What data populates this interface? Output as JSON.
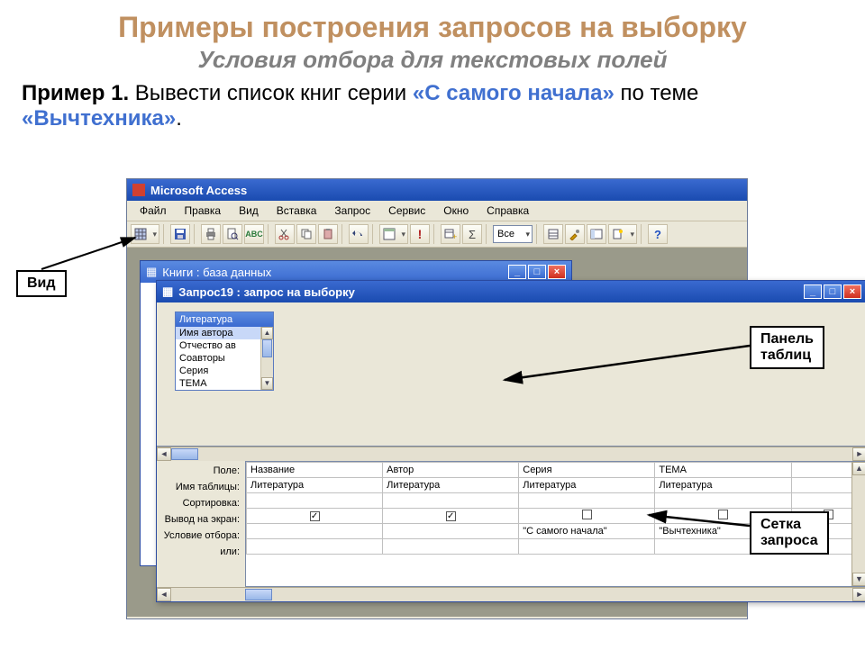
{
  "slide": {
    "title": "Примеры построения запросов на выборку",
    "subtitle": "Условия отбора для текстовых полей",
    "ex_prefix": "Пример 1.",
    "ex_body1": " Вывести список книг серии ",
    "ex_blue1": "«С самого начала»",
    "ex_body2": " по теме ",
    "ex_blue2": "«Вычтехника»",
    "ex_tail": "."
  },
  "callouts": {
    "view": "Вид",
    "tables_panel": "Панель\nтаблиц",
    "query_grid": "Сетка\nзапроса"
  },
  "access": {
    "app_title": "Microsoft Access",
    "menus": [
      "Файл",
      "Правка",
      "Вид",
      "Вставка",
      "Запрос",
      "Сервис",
      "Окно",
      "Справка"
    ],
    "combo_all": "Все",
    "db_window_title": "Книги : база данных",
    "query_window_title": "Запрос19 : запрос на выборку",
    "table_source": {
      "name": "Литература",
      "fields": [
        "Имя автора",
        "Отчество ав",
        "Соавторы",
        "Серия",
        "ТЕМА"
      ]
    },
    "grid_labels": {
      "field": "Поле:",
      "table": "Имя таблицы:",
      "sort": "Сортировка:",
      "show": "Вывод на экран:",
      "criteria": "Условие отбора:",
      "or": "или:"
    },
    "grid_cols": [
      {
        "field": "Название",
        "table": "Литература",
        "show": true,
        "criteria": ""
      },
      {
        "field": "Автор",
        "table": "Литература",
        "show": true,
        "criteria": ""
      },
      {
        "field": "Серия",
        "table": "Литература",
        "show": false,
        "criteria": "\"С самого начала\""
      },
      {
        "field": "ТЕМА",
        "table": "Литература",
        "show": false,
        "criteria": "\"Вычтехника\""
      }
    ]
  }
}
